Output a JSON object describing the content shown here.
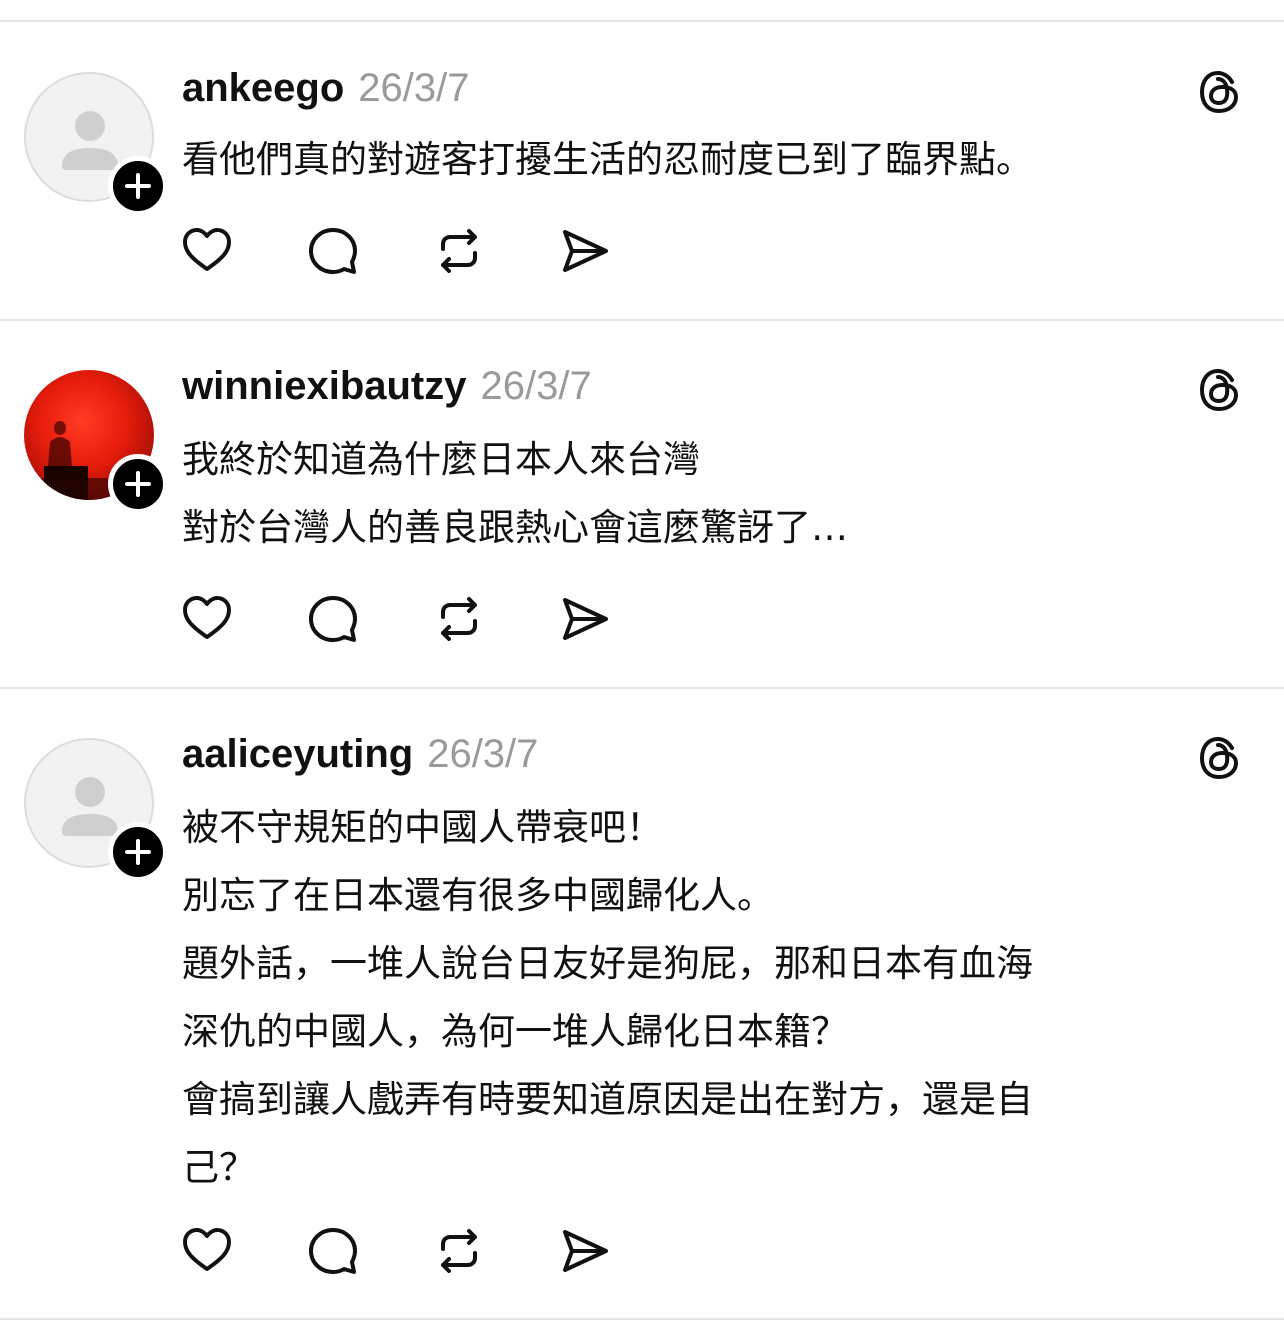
{
  "posts": [
    {
      "username": "ankeego",
      "timestamp": "26/3/7",
      "avatar": "default-avatar",
      "lines": [
        "看他們真的對遊客打擾生活的忍耐度已到了臨界點。"
      ]
    },
    {
      "username": "winniexibautzy",
      "timestamp": "26/3/7",
      "avatar": "red-photo-avatar",
      "lines": [
        "我終於知道為什麼日本人來台灣",
        "對於台灣人的善良跟熱心會這麼驚訝了…"
      ]
    },
    {
      "username": "aaliceyuting",
      "timestamp": "26/3/7",
      "avatar": "default-avatar",
      "lines": [
        "被不守規矩的中國人帶衰吧！",
        "別忘了在日本還有很多中國歸化人。",
        "題外話，一堆人說台日友好是狗屁，那和日本有血海",
        "深仇的中國人，為何一堆人歸化日本籍？",
        "會搞到讓人戲弄有時要知道原因是出在對方，還是自",
        "己？"
      ]
    }
  ],
  "icons": {
    "like": "heart-icon",
    "reply": "comment-icon",
    "repost": "repost-icon",
    "share": "send-icon",
    "platform": "threads-logo-icon",
    "follow": "plus-icon"
  },
  "colors": {
    "text": "#111111",
    "timestamp": "#9a9a9a",
    "divider": "#e6e6e6",
    "badge": "#000000"
  }
}
